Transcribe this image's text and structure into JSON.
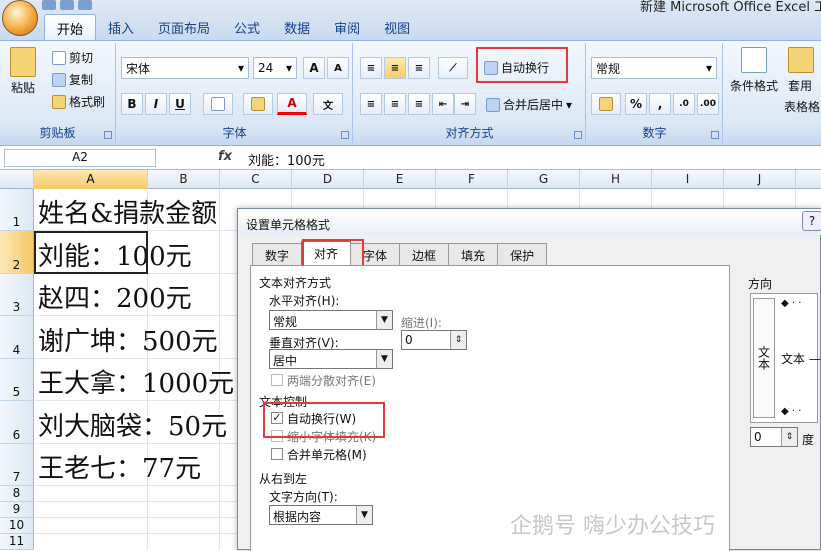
{
  "app": {
    "title": "新建 Microsoft Office Excel 工作"
  },
  "tabs": [
    "开始",
    "插入",
    "页面布局",
    "公式",
    "数据",
    "审阅",
    "视图"
  ],
  "clipboard": {
    "paste": "粘贴",
    "cut": "剪切",
    "copy": "复制",
    "format_painter": "格式刷",
    "label": "剪贴板"
  },
  "font": {
    "name": "宋体",
    "size": "24",
    "bold": "B",
    "italic": "I",
    "underline": "U",
    "grow": "A",
    "shrink": "A",
    "color": "A",
    "phonetic": "文",
    "label": "字体"
  },
  "alignment": {
    "wrap_text": "自动换行",
    "merge_center": "合并后居中",
    "label": "对齐方式"
  },
  "number": {
    "format": "常规",
    "percent": "%",
    "comma": ",",
    "label": "数字"
  },
  "styles": {
    "conditional": "条件格式",
    "table": "套用",
    "table2": "表格格"
  },
  "formula_bar": {
    "name_box": "A2",
    "fx": "fx",
    "content": "刘能：100元"
  },
  "columns": [
    "A",
    "B",
    "C",
    "D",
    "E",
    "F",
    "G",
    "H",
    "I",
    "J"
  ],
  "rows": [
    "1",
    "2",
    "3",
    "4",
    "5",
    "6",
    "7",
    "8",
    "9",
    "10",
    "11"
  ],
  "cells": [
    "姓名&捐款金额",
    "刘能：100元",
    "赵四：200元",
    "谢广坤：500元",
    "王大拿：1000元",
    "刘大脑袋：50元",
    "王老七：77元"
  ],
  "dialog": {
    "title": "设置单元格格式",
    "help": "?",
    "tabs": [
      "数字",
      "对齐",
      "字体",
      "边框",
      "填充",
      "保护"
    ],
    "text_align_section": "文本对齐方式",
    "horizontal_label": "水平对齐(H):",
    "horizontal_value": "常规",
    "indent_label": "缩进(I):",
    "indent_value": "0",
    "vertical_label": "垂直对齐(V):",
    "vertical_value": "居中",
    "distributed": "两端分散对齐(E)",
    "text_control": "文本控制",
    "wrap": "自动换行(W)",
    "shrink": "缩小字体填充(K)",
    "merge": "合并单元格(M)",
    "rtl": "从右到左",
    "direction_label": "文字方向(T):",
    "direction_value": "根据内容",
    "orientation": "方向",
    "orient_text_v": "文本",
    "orient_text_h": "文本 —",
    "degree_value": "0",
    "degree_unit": "度"
  },
  "watermark": "企鹅号 嗨少办公技巧",
  "colors": {
    "highlight": "#e53a3a",
    "ribbon": "#dbe7f5",
    "title_blue": "#15428b"
  }
}
